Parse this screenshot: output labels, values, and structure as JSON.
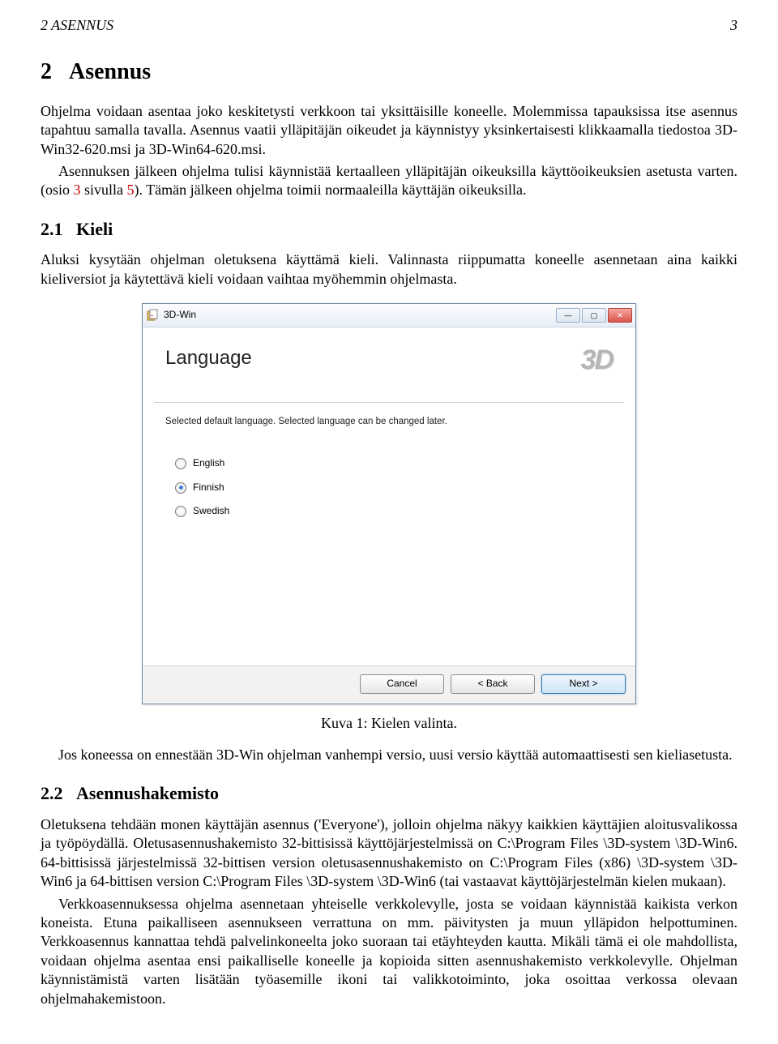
{
  "header": {
    "left": "2   ASENNUS",
    "right": "3"
  },
  "sec": {
    "num": "2",
    "title": "Asennus"
  },
  "p1": "Ohjelma voidaan asentaa joko keskitetysti verkkoon tai yksittäisille koneelle. Molemmissa tapauksissa itse asennus tapahtuu samalla tavalla. Asennus vaatii ylläpitäjän oikeudet ja käynnistyy yksinkertaisesti klikkaamalla tiedostoa 3D-Win32-620.msi ja 3D-Win64-620.msi.",
  "p2a": "Asennuksen jälkeen ohjelma tulisi käynnistää kertaalleen ylläpitäjän oikeuksilla käyttöoikeuksien asetusta varten. (osio ",
  "p2ref": "3",
  "p2b": " sivulla ",
  "p2ref2": "5",
  "p2c": "). Tämän jälkeen ohjelma toimii normaaleilla käyttäjän oikeuksilla.",
  "sub1": {
    "num": "2.1",
    "title": "Kieli"
  },
  "p3": "Aluksi kysytään ohjelman oletuksena käyttämä kieli. Valinnasta riippumatta koneelle asennetaan aina kaikki kieliversiot ja käytettävä kieli voidaan vaihtaa myöhemmin ohjelmasta.",
  "window": {
    "title": "3D-Win",
    "header": "Language",
    "brand": "3D",
    "desc": "Selected default language. Selected language can be changed later.",
    "options": [
      "English",
      "Finnish",
      "Swedish"
    ],
    "selected": 1,
    "buttons": {
      "cancel": "Cancel",
      "back": "< Back",
      "next": "Next >"
    }
  },
  "caption": "Kuva 1: Kielen valinta.",
  "p4": "Jos koneessa on ennestään 3D-Win ohjelman vanhempi versio, uusi versio käyttää automaattisesti sen kieliasetusta.",
  "sub2": {
    "num": "2.2",
    "title": "Asennushakemisto"
  },
  "p5": "Oletuksena tehdään monen käyttäjän asennus ('Everyone'), jolloin ohjelma näkyy kaikkien käyttäjien aloitusvalikossa ja työpöydällä. Oletusasennushakemisto 32-bittisissä käyttöjärjestelmissä on C:\\Program Files \\3D-system \\3D-Win6. 64-bittisissä järjestelmissä 32-bittisen version oletusasennushakemisto on C:\\Program Files (x86) \\3D-system \\3D-Win6 ja 64-bittisen version C:\\Program Files \\3D-system \\3D-Win6 (tai vastaavat käyttöjärjestelmän kielen mukaan).",
  "p6": "Verkkoasennuksessa ohjelma asennetaan yhteiselle verkkolevylle, josta se voidaan käynnistää kaikista verkon koneista. Etuna paikalliseen asennukseen verrattuna on mm. päivitysten ja muun ylläpidon helpottuminen. Verkkoasennus kannattaa tehdä palvelinkoneelta joko suoraan tai etäyhteyden kautta. Mikäli tämä ei ole mahdollista, voidaan ohjelma asentaa ensi paikalliselle koneelle ja kopioida sitten asennushakemisto verkkolevylle. Ohjelman käynnistämistä varten lisätään työasemille ikoni tai valikkotoiminto, joka osoittaa verkossa olevaan ohjelmahakemistoon."
}
